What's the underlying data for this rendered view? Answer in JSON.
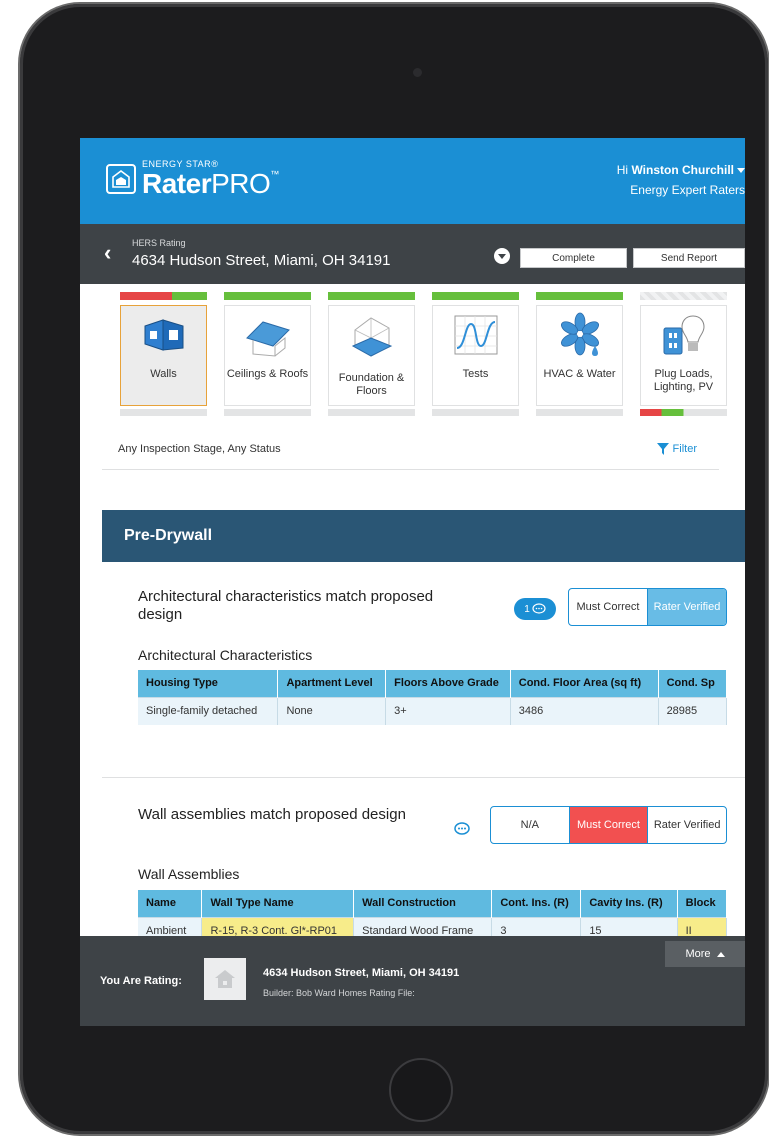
{
  "app": {
    "brand_small": "ENERGY STAR",
    "brand_reg": "®",
    "brand_rater": "Rater",
    "brand_pro": "PRO",
    "brand_tm": "™"
  },
  "user": {
    "greeting": "Hi",
    "name": "Winston Churchill",
    "org": "Energy Expert Raters"
  },
  "subheader": {
    "label": "HERS Rating",
    "address": "4634 Hudson Street, Miami, OH 34191",
    "complete_label": "Complete",
    "send_label": "Send Report"
  },
  "categories": [
    {
      "label": "Walls",
      "icon": "walls-icon",
      "active": true
    },
    {
      "label": "Ceilings & Roofs",
      "icon": "roof-icon"
    },
    {
      "label": "Foundation & Floors",
      "icon": "foundation-icon"
    },
    {
      "label": "Tests",
      "icon": "tests-icon"
    },
    {
      "label": "HVAC & Water",
      "icon": "hvac-icon"
    },
    {
      "label": "Plug Loads, Lighting, PV",
      "icon": "plug-icon"
    }
  ],
  "filter": {
    "status": "Any Inspection Stage, Any Status",
    "label": "Filter"
  },
  "section": {
    "title": "Pre-Drywall"
  },
  "item1": {
    "title": "Architectural characteristics match proposed design",
    "comment_count": "1",
    "options": [
      "Must Correct",
      "Rater Verified"
    ],
    "table_title": "Architectural Characteristics",
    "headers": [
      "Housing Type",
      "Apartment Level",
      "Floors Above Grade",
      "Cond. Floor Area (sq ft)",
      "Cond. Sp"
    ],
    "row": [
      "Single-family detached",
      "None",
      "3+",
      "3486",
      "28985"
    ]
  },
  "item2": {
    "title": "Wall assemblies match proposed design",
    "options": [
      "N/A",
      "Must Correct",
      "Rater Verified"
    ],
    "table_title": "Wall Assemblies",
    "headers": [
      "Name",
      "Wall Type Name",
      "Wall Construction",
      "Cont. Ins. (R)",
      "Cavity Ins. (R)",
      "Block"
    ],
    "row": [
      "Ambient",
      "R-15, R-3 Cont. Gl*-RP01",
      "Standard Wood Frame",
      "3",
      "15",
      "II"
    ]
  },
  "bottom": {
    "more_label": "More",
    "you_are_rating": "You Are Rating:",
    "address": "4634 Hudson Street, Miami, OH 34191",
    "builder": "Builder: Bob Ward Homes Rating File:"
  },
  "colors": {
    "header_blue": "#1b8fd4",
    "section_navy": "#2a5675",
    "status_green": "#66bf3c",
    "status_red": "#e64545"
  }
}
